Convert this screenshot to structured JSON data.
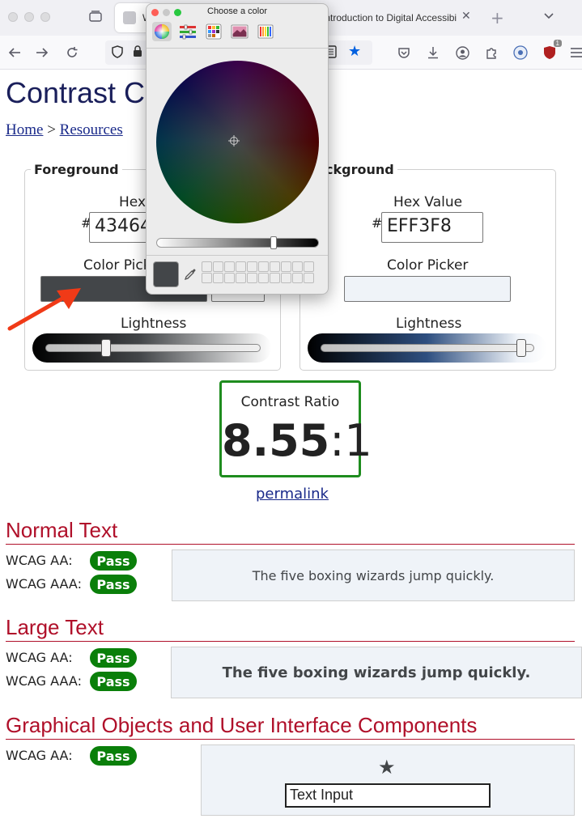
{
  "browser": {
    "tab_active_title": "W",
    "tab_other_title": "Introduction to Digital Accessibi",
    "tab_close_glyph": "✕",
    "new_tab_glyph": "+",
    "extension_badge": "1",
    "icons": [
      "window-buttons",
      "tab-overview-icon",
      "back-icon",
      "forward-icon",
      "reload-icon",
      "shield-icon",
      "lock-icon",
      "reader-view-icon",
      "bookmark-star-icon",
      "pocket-icon",
      "download-icon",
      "account-icon",
      "extensions-icon",
      "accessibility-extension-icon",
      "ublock-icon",
      "menu-icon"
    ]
  },
  "page": {
    "title": "Contrast Ch",
    "breadcrumb": {
      "home": "Home",
      "separator": " > ",
      "resources": "Resources"
    }
  },
  "foreground": {
    "legend": "Foreground",
    "hex_label": "Hex",
    "hash": "#",
    "hex_value": "43464",
    "picker_label": "Color Pick",
    "lightness_label": "Lightness",
    "color": "#434649",
    "lightness_percent": 27
  },
  "background": {
    "legend": "ckground",
    "hex_label": "Hex Value",
    "hash": "#",
    "hex_value": "EFF3F8",
    "picker_label": "Color Picker",
    "lightness_label": "Lightness",
    "color": "#EFF3F8",
    "lightness_percent": 96
  },
  "contrast": {
    "label": "Contrast Ratio",
    "ratio_main": "8.55",
    "ratio_suffix": ":1",
    "permalink": "permalink",
    "border_color": "#1e8c1e"
  },
  "sections": {
    "normal": {
      "heading": "Normal Text",
      "aa_label": "WCAG AA:",
      "aa_result": "Pass",
      "aaa_label": "WCAG AAA:",
      "aaa_result": "Pass",
      "sample": "The five boxing wizards jump quickly."
    },
    "large": {
      "heading": "Large Text",
      "aa_label": "WCAG AA:",
      "aa_result": "Pass",
      "aaa_label": "WCAG AAA:",
      "aaa_result": "Pass",
      "sample": "The five boxing wizards jump quickly."
    },
    "graphical": {
      "heading": "Graphical Objects and User Interface Components",
      "aa_label": "WCAG AA:",
      "aa_result": "Pass",
      "star": "★",
      "input_text": "Text Input"
    }
  },
  "color_picker": {
    "title": "Choose a color",
    "modes": [
      "color-wheel-icon",
      "sliders-icon",
      "palettes-icon",
      "image-palettes-icon",
      "pencils-icon"
    ],
    "selected_color": "#434649",
    "brightness_percent": 73
  },
  "colors": {
    "heading_red": "#b0102a",
    "pass_green": "#0a7f0a",
    "arrow": "#f03a17",
    "link": "#1a2a8a"
  }
}
